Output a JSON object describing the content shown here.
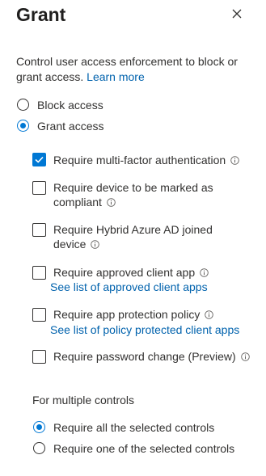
{
  "panel": {
    "title": "Grant",
    "description": "Control user access enforcement to block or grant access.",
    "learn_more": "Learn more"
  },
  "access": {
    "options": [
      {
        "label": "Block access",
        "checked": false
      },
      {
        "label": "Grant access",
        "checked": true
      }
    ]
  },
  "controls": [
    {
      "line1": "Require multi-factor authentication",
      "line2": "",
      "link": "",
      "checked": true
    },
    {
      "line1": "Require device to be marked as",
      "line2": "compliant",
      "link": "",
      "checked": false
    },
    {
      "line1": "Require Hybrid Azure AD joined",
      "line2": "device",
      "link": "",
      "checked": false
    },
    {
      "line1": "Require approved client app",
      "line2": "",
      "link": "See list of approved client apps",
      "checked": false
    },
    {
      "line1": "Require app protection policy",
      "line2": "",
      "link": "See list of policy protected client apps",
      "checked": false
    },
    {
      "line1": "Require password change (Preview)",
      "line2": "",
      "link": "",
      "checked": false
    }
  ],
  "multiple": {
    "label": "For multiple controls",
    "options": [
      {
        "label": "Require all the selected controls",
        "checked": true
      },
      {
        "label": "Require one of the selected controls",
        "checked": false
      }
    ]
  },
  "icons": {
    "close": "close-icon",
    "info": "info-icon",
    "check": "checkmark-icon"
  },
  "colors": {
    "accent": "#0078d4",
    "link": "#0062ad",
    "text": "#323130"
  }
}
